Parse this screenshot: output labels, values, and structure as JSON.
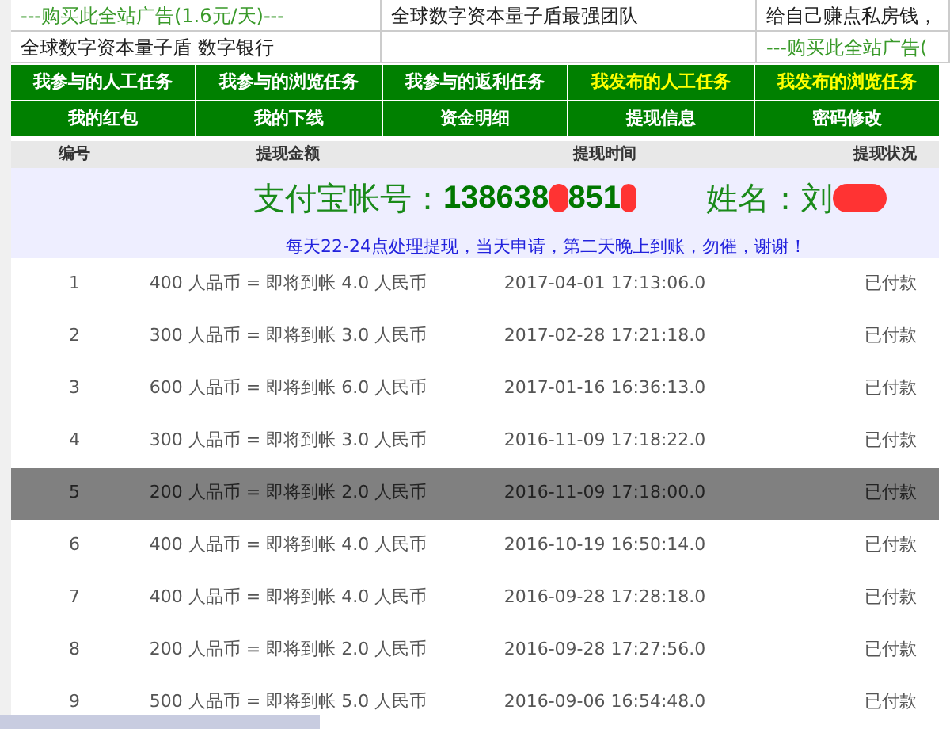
{
  "ads": [
    [
      {
        "text": "---购买此全站广告(1.6元/天)---",
        "kind": "promo"
      },
      {
        "text": "全球数字资本量子盾最强团队",
        "kind": "plain"
      },
      {
        "text": "给自己赚点私房钱，",
        "kind": "plain"
      }
    ],
    [
      {
        "text": "全球数字资本量子盾 数字银行",
        "kind": "plain"
      },
      {
        "kind": "empty"
      },
      {
        "text": "---购买此全站广告(",
        "kind": "promo"
      }
    ]
  ],
  "nav": [
    [
      {
        "label": "我参与的人工任务",
        "highlighted": false
      },
      {
        "label": "我参与的浏览任务",
        "highlighted": false
      },
      {
        "label": "我参与的返利任务",
        "highlighted": false
      },
      {
        "label": "我发布的人工任务",
        "highlighted": true
      },
      {
        "label": "我发布的浏览任务",
        "highlighted": true
      }
    ],
    [
      {
        "label": "我的红包",
        "highlighted": false
      },
      {
        "label": "我的下线",
        "highlighted": false
      },
      {
        "label": "资金明细",
        "highlighted": false
      },
      {
        "label": "提现信息",
        "highlighted": false
      },
      {
        "label": "密码修改",
        "highlighted": false
      }
    ]
  ],
  "table": {
    "columns": [
      "编号",
      "提现金额",
      "提现时间",
      "提现状况"
    ],
    "account": {
      "label": "支付宝帐号：",
      "number_start": "138638",
      "number_mid": "851",
      "name_label": "姓名：",
      "name_start": "刘"
    },
    "notice": "每天22-24点处理提现，当天申请，第二天晚上到账，勿催，谢谢！",
    "rows": [
      {
        "no": "1",
        "amount": "400 人品币 = 即将到帐 4.0 人民币",
        "time": "2017-04-01 17:13:06.0",
        "status": "已付款",
        "selected": false
      },
      {
        "no": "2",
        "amount": "300 人品币 = 即将到帐 3.0 人民币",
        "time": "2017-02-28 17:21:18.0",
        "status": "已付款",
        "selected": false
      },
      {
        "no": "3",
        "amount": "600 人品币 = 即将到帐 6.0 人民币",
        "time": "2017-01-16 16:36:13.0",
        "status": "已付款",
        "selected": false
      },
      {
        "no": "4",
        "amount": "300 人品币 = 即将到帐 3.0 人民币",
        "time": "2016-11-09 17:18:22.0",
        "status": "已付款",
        "selected": false
      },
      {
        "no": "5",
        "amount": "200 人品币 = 即将到帐 2.0 人民币",
        "time": "2016-11-09 17:18:00.0",
        "status": "已付款",
        "selected": true
      },
      {
        "no": "6",
        "amount": "400 人品币 = 即将到帐 4.0 人民币",
        "time": "2016-10-19 16:50:14.0",
        "status": "已付款",
        "selected": false
      },
      {
        "no": "7",
        "amount": "400 人品币 = 即将到帐 4.0 人民币",
        "time": "2016-09-28 17:28:18.0",
        "status": "已付款",
        "selected": false
      },
      {
        "no": "8",
        "amount": "200 人品币 = 即将到帐 2.0 人民币",
        "time": "2016-09-28 17:27:56.0",
        "status": "已付款",
        "selected": false
      },
      {
        "no": "9",
        "amount": "500 人品币 = 即将到帐 5.0 人民币",
        "time": "2016-09-06 16:54:48.0",
        "status": "已付款",
        "selected": false
      }
    ]
  }
}
